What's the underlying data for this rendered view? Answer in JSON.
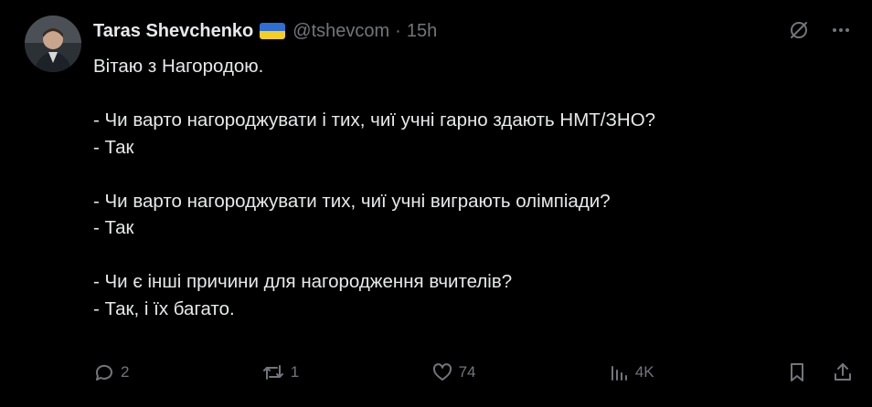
{
  "author": {
    "name": "Taras Shevchenko",
    "handle": "@tshevcom",
    "separator": "·",
    "time": "15h",
    "flag_colors": [
      "#2e6fd6",
      "#f5cf20"
    ]
  },
  "tweet": {
    "text": "Вітаю з Нагородою.\n\n- Чи варто нагороджувати і тих, чиї учні гарно здають НМТ/ЗНО?\n- Так\n\n- Чи варто нагороджувати тих, чиї учні виграють олімпіади?\n- Так\n\n- Чи є інші причини для нагородження вчителів?\n- Так, і їх багато."
  },
  "top_actions": {
    "icons": [
      "grok-icon",
      "more-icon"
    ]
  },
  "actions": {
    "replies": "2",
    "reposts": "1",
    "likes": "74",
    "views": "4K"
  },
  "colors": {
    "background": "#000000",
    "text": "#e7e9ea",
    "muted": "#71767b"
  }
}
